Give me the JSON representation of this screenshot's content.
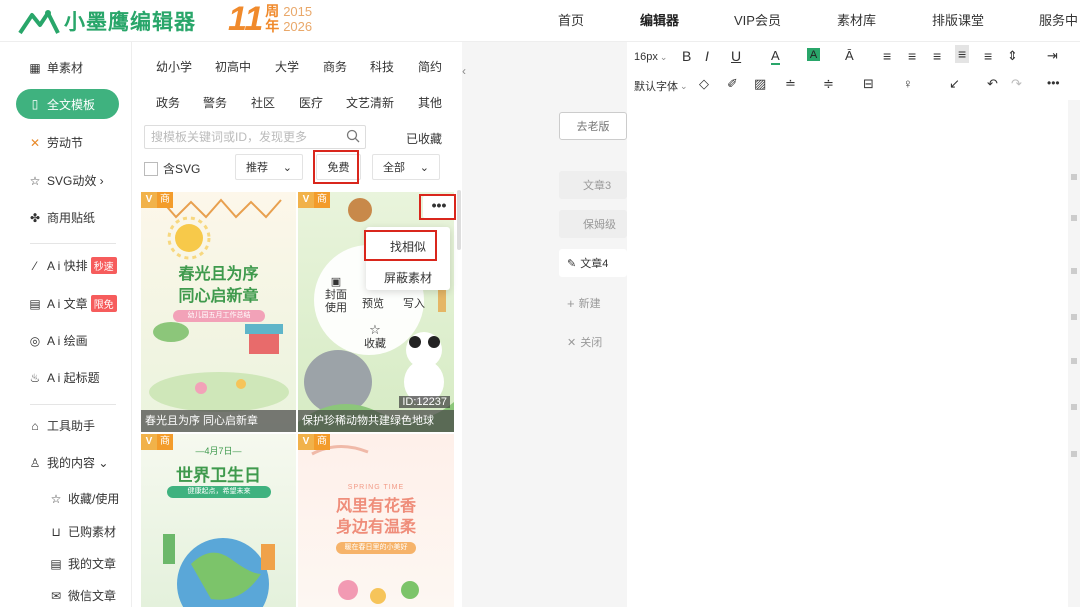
{
  "brand": {
    "name": "小墨鹰编辑器",
    "anniv_num": "11",
    "anniv_line1": "周",
    "anniv_year1": "2015",
    "anniv_line2": "年",
    "anniv_year2": "2026"
  },
  "nav": [
    "首页",
    "编辑器",
    "VIP会员",
    "素材库",
    "排版课堂",
    "服务中"
  ],
  "leftnav": {
    "single": "单素材",
    "fulltpl": "全文模板",
    "labor": "劳动节",
    "svg": "SVG动效 ›",
    "sticker": "商用贴纸",
    "ai_quick": "A i 快排",
    "ai_quick_tag": "秒速",
    "ai_article": "A i 文章",
    "ai_article_tag": "限免",
    "ai_paint": "A i 绘画",
    "ai_title": "A i 起标题",
    "tools": "工具助手",
    "mine": "我的内容 ⌄",
    "fav": "收藏/使用",
    "bought": "已购素材",
    "myarticle": "我的文章",
    "wechat": "微信文章"
  },
  "categories": [
    "幼小学",
    "初高中",
    "大学",
    "商务",
    "科技",
    "简约",
    "政务",
    "警务",
    "社区",
    "医疗",
    "文艺清新",
    "其他"
  ],
  "search": {
    "placeholder": "搜模板关键词或ID，发现更多",
    "saved": "已收藏"
  },
  "filters": {
    "svg": "含SVG",
    "sort": "推荐",
    "free": "免费",
    "all": "全部"
  },
  "cards": [
    {
      "caption": "春光且为序 同心启新章",
      "title1": "春光且为序",
      "title2": "同心启新章",
      "sub": "幼儿园五月工作总结",
      "badge_v": "V",
      "badge_s": "商"
    },
    {
      "caption": "保护珍稀动物共建绿色地球",
      "id": "ID:12237",
      "badge_v": "V",
      "badge_s": "商"
    },
    {
      "date": "—4月7日—",
      "title": "世界卫生日",
      "sub": "健康起点，希望未来",
      "badge_v": "V",
      "badge_s": "商"
    },
    {
      "eyebrow": "SPRING TIME",
      "title1": "风里有花香",
      "title2": "身边有温柔",
      "sub": "暖在春日里的小美好",
      "badge_v": "V",
      "badge_s": "商"
    }
  ],
  "hover_menu": {
    "find_similar": "找相似",
    "block": "屏蔽素材",
    "cover1": "封面",
    "cover2": "使用",
    "preview": "预览",
    "write": "写入",
    "collect": "收藏",
    "more": "•••"
  },
  "middle": {
    "old": "去老版",
    "art3": "文章3",
    "nanny": "保姆级",
    "art4": "文章4",
    "new": "新建",
    "close": "关闭"
  },
  "toolbar": {
    "size": "16px",
    "font": "默认字体"
  },
  "colors": {
    "brand": "#29a66a",
    "active": "#3fb27f",
    "accent": "#f08a2c",
    "highlight": "#d9261c"
  }
}
